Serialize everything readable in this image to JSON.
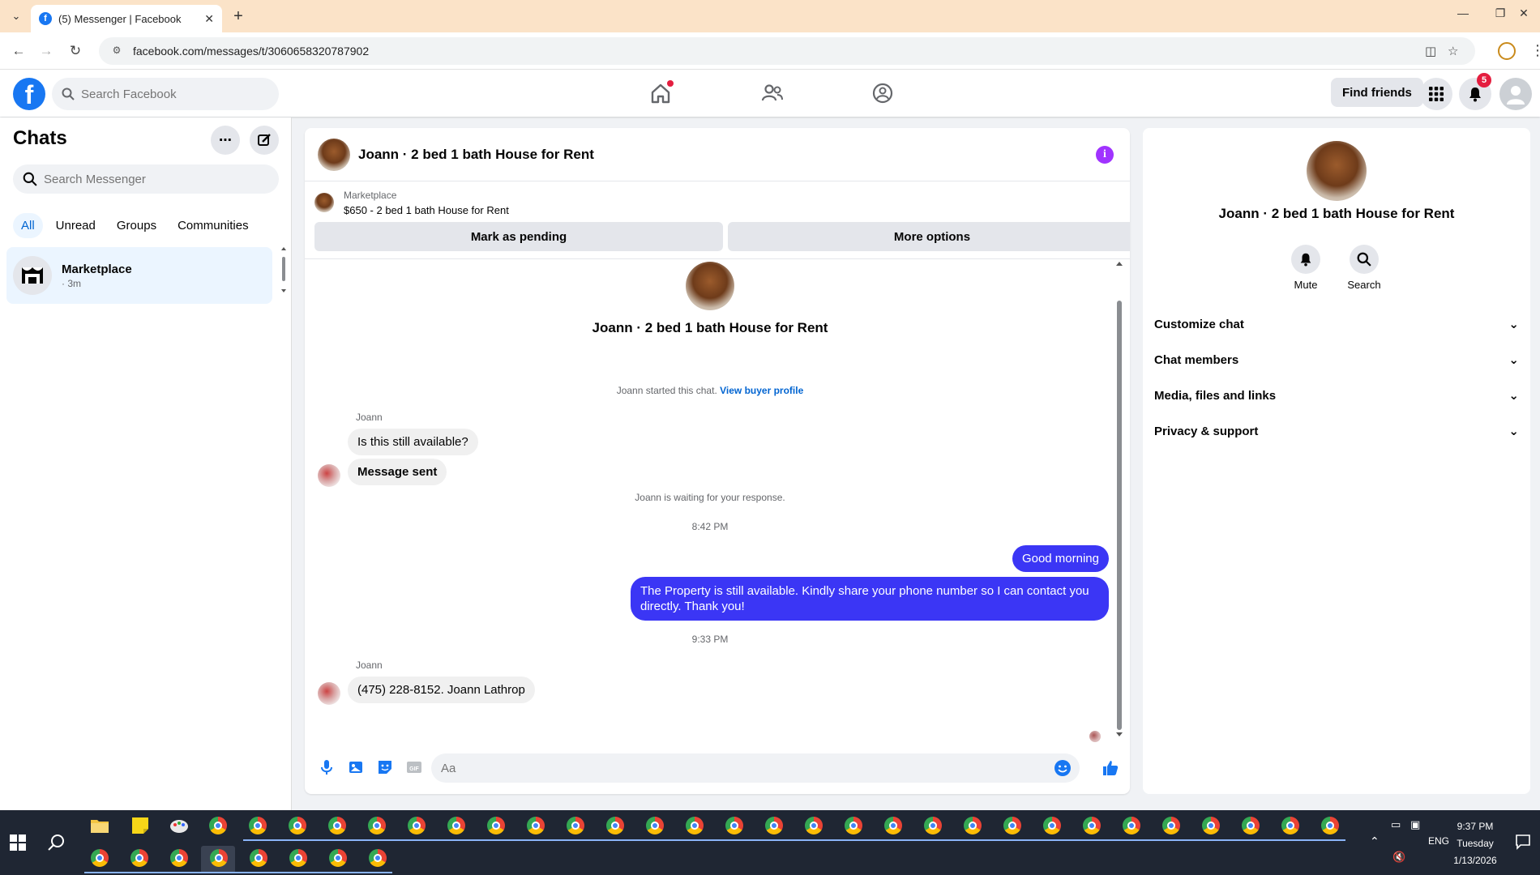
{
  "browser": {
    "tab_title": "(5) Messenger | Facebook",
    "url": "facebook.com/messages/t/3060658320787902"
  },
  "fb_header": {
    "search_placeholder": "Search Facebook",
    "find_friends": "Find friends",
    "notification_count": "5"
  },
  "chats": {
    "title": "Chats",
    "search_placeholder": "Search Messenger",
    "filters": [
      "All",
      "Unread",
      "Groups",
      "Communities"
    ],
    "active_filter": "All",
    "items": [
      {
        "name": "Marketplace",
        "time": "· 3m"
      }
    ]
  },
  "conversation": {
    "title": "Joann · 2 bed 1 bath House for Rent",
    "marketplace_label": "Marketplace",
    "listing": "$650 - 2 bed 1 bath House for Rent",
    "mark_pending": "Mark as pending",
    "more_options": "More options",
    "intro_title": "Joann · 2 bed 1 bath House for Rent",
    "started_text": "Joann started this chat.",
    "view_profile": "View buyer profile",
    "messages": [
      {
        "sender": "Joann",
        "text": "Is this still available?"
      },
      {
        "sender": "Joann",
        "text": "Message sent"
      }
    ],
    "waiting_text": "Joann is waiting for your response.",
    "time_1": "8:42 PM",
    "outgoing": [
      {
        "text": "Good morning"
      },
      {
        "text": "The Property is still available. Kindly share your phone number so I can contact you directly. Thank you!"
      }
    ],
    "time_2": "9:33 PM",
    "reply": {
      "sender": "Joann",
      "text": "(475) 228-8152. Joann Lathrop"
    },
    "composer_placeholder": "Aa"
  },
  "info_panel": {
    "title": "Joann · 2 bed 1 bath House for Rent",
    "mute": "Mute",
    "search": "Search",
    "sections": [
      "Customize chat",
      "Chat members",
      "Media, files and links",
      "Privacy & support"
    ]
  },
  "taskbar": {
    "time": "9:37 PM",
    "day": "Tuesday",
    "date": "1/13/2026",
    "lang": "ENG"
  },
  "colors": {
    "accent": "#1877f2",
    "outgoing_bubble": "#3b36f5",
    "info_purple": "#a033ff"
  }
}
